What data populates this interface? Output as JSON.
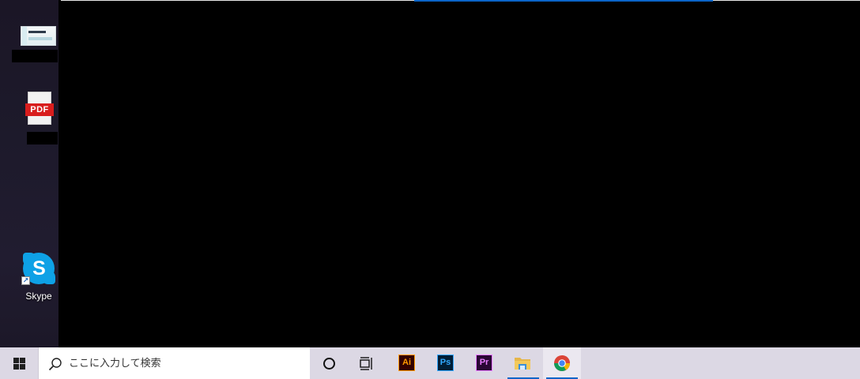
{
  "desktop": {
    "icons": [
      {
        "name": "thumbnail-document",
        "label": ""
      },
      {
        "name": "pdf-document",
        "glyph": "PDF",
        "label": ""
      },
      {
        "name": "skype",
        "glyph": "S",
        "label": "Skype"
      }
    ]
  },
  "taskbar": {
    "search_placeholder": "ここに入力して検索",
    "apps": [
      {
        "icon": "cortana-circle-icon",
        "label": ""
      },
      {
        "icon": "task-view-icon",
        "label": ""
      },
      {
        "icon": "illustrator-icon",
        "label": "Ai"
      },
      {
        "icon": "photoshop-icon",
        "label": "Ps"
      },
      {
        "icon": "premiere-icon",
        "label": "Pr"
      },
      {
        "icon": "file-explorer-icon",
        "label": ""
      },
      {
        "icon": "chrome-icon",
        "label": ""
      }
    ]
  },
  "colors": {
    "taskbar_bg": "#dcd8e4",
    "accent_blue": "#0a64c8",
    "skype_blue": "#0ea1e6",
    "pdf_red": "#d81d1d"
  }
}
